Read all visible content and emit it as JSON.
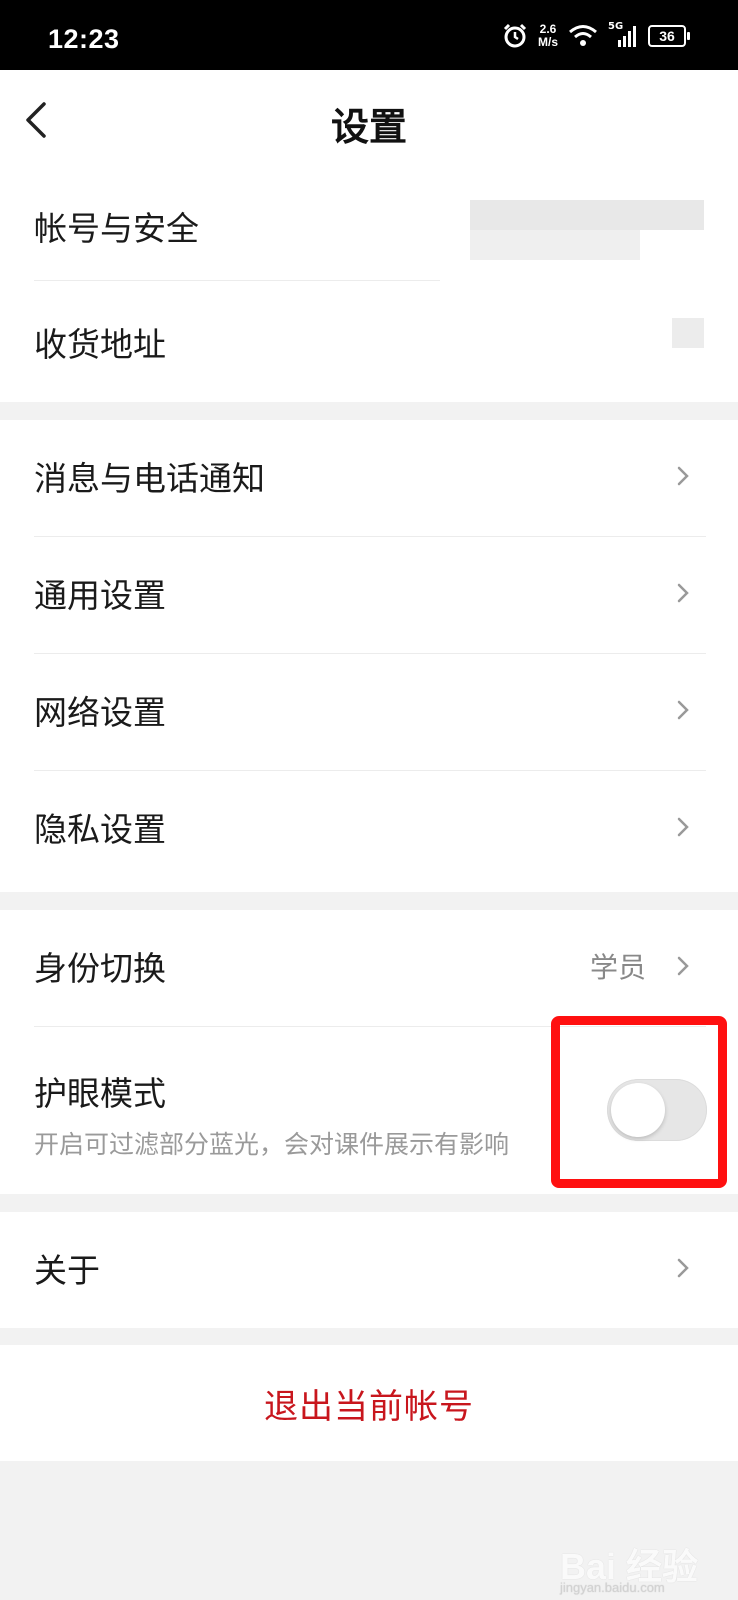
{
  "status_bar": {
    "time": "12:23",
    "net_speed_value": "2.6",
    "net_speed_unit": "M/s",
    "network_type": "5G",
    "battery": "36",
    "icons": [
      "alarm-icon",
      "wifi-icon",
      "signal-icon",
      "battery-icon"
    ]
  },
  "header": {
    "title": "设置",
    "back_icon": "chevron-left-icon"
  },
  "group1": {
    "items": [
      {
        "label": "帐号与安全"
      },
      {
        "label": "收货地址"
      }
    ]
  },
  "group2": {
    "items": [
      {
        "label": "消息与电话通知"
      },
      {
        "label": "通用设置"
      },
      {
        "label": "网络设置"
      },
      {
        "label": "隐私设置"
      }
    ]
  },
  "group3": {
    "identity": {
      "label": "身份切换",
      "value": "学员"
    },
    "eye_mode": {
      "label": "护眼模式",
      "description": "开启可过滤部分蓝光，会对课件展示有影响",
      "enabled": false
    }
  },
  "group4": {
    "items": [
      {
        "label": "关于"
      }
    ]
  },
  "logout": {
    "label": "退出当前帐号"
  },
  "watermark": {
    "text": "Bai 经验",
    "sub": "jingyan.baidu.com"
  },
  "colors": {
    "accent_red": "#c8161d",
    "highlight_red": "#ff1010",
    "background": "#f2f2f2"
  }
}
